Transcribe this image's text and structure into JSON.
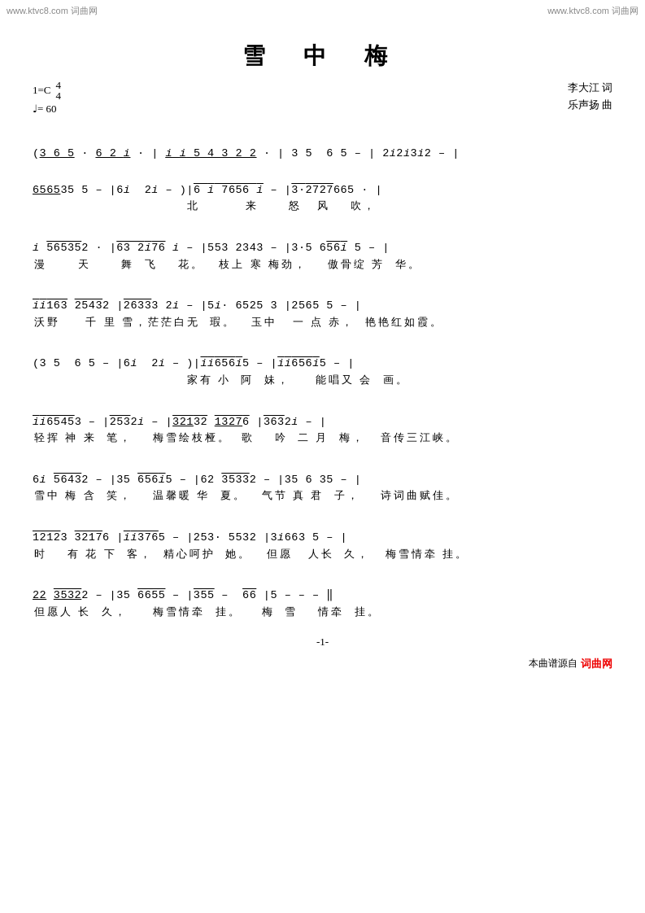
{
  "watermark": {
    "left": "www.ktvc8.com 词曲网",
    "right": "www.ktvc8.com 词曲网"
  },
  "title": "雪 中 梅",
  "meta": {
    "key": "1=C",
    "time_top": "4",
    "time_bottom": "4",
    "tempo": "♩= 60",
    "lyricist_label": "李大江  词",
    "composer_label": "乐声扬  曲"
  },
  "footer": {
    "source_text": "本曲谱源自",
    "brand": "词曲网"
  },
  "page_number": "-1-",
  "lines": [
    {
      "notes": "(3 6 5 ·  6 2 i ·  | i i 5 4 3 2 2 ·  | 3 5  6 5  –  | 2 i 2 i 3 i 2  –  |",
      "lyrics": ""
    },
    {
      "notes": " 6 5 6 5 3 5 5  –  | 6 i  2 i  – ) | 6 i 7 6 5 6 i  –  | 3 · 2 7 2 7 6 6 5 ·  |",
      "lyrics": "                              北         来      怒  风    吹，"
    },
    {
      "notes": " i  5 6 5 3 5 2 ·  | 6 3 2 i 7 6 i  –  | 5 5 3 2 3 4 3  –  | 3 · 5 6 5 6 i 5  –  |",
      "lyrics": "漫      天      舞  飞    花。   枝上 寒 梅劲，    傲骨绽 芳  华。"
    },
    {
      "notes": " i i 1 6 3  2 5 4 3 2 | 2 6 3 3 3 2 i  –  | 5 i ·  6 5 2 5 3 | 2 5 6 5 5  –  |",
      "lyrics": "沃野    千 里 雪，茫茫白无  瑕。   玉中   一 点 赤，  艳艳红如霞。"
    },
    {
      "notes": "(3 5  6 5  –  | 6 i  2 i  – ) | i i 6 5 6 i 5  –  | i i 6 5 6 i 5  –  |",
      "lyrics": "                              家有 小  阿  妹，     能唱又 会  画。"
    },
    {
      "notes": " i i 6 5 4 5 3  –  | 2 5 3 2 i  –  | 3 2 i 3 2  i 3 2 7 6 | 3 6 3 2 i  –  |",
      "lyrics": "轻挥 神 来  笔，    梅雪绘枝桠。  歌    吟  二 月  梅，   音传三江峡。"
    },
    {
      "notes": " 6 i  5 6 4 3 2  –  | 3 5  6 5 6 i 5  –  | 6 2  3 5 3 3 2  –  | 3 5  6 3 5  –  |",
      "lyrics": "雪中 梅 含  笑，    温馨暖 华  夏。   气节 真 君  子，    诗词曲赋佳。"
    },
    {
      "notes": " i 2 i 2 3  3 2 i 7 6 | i i 3 7 6 5  –  | 2 5 3 ·  5 5 3 2 | 3 i 6 6 3 5  –  |",
      "lyrics": "时    有 花 下  客，  精心呵护  她。   但愿   人长  久，   梅雪情牵 挂。"
    },
    {
      "notes": " 2 2  3 5 3 2 2  –  | 3 5  6 6 5 5  –  | 3 5 5  –  6 6 | 5  –  –  –  ‖",
      "lyrics": "但愿人 长  久，     梅雪情牵  挂。    梅  雪    情牵  挂。"
    }
  ]
}
